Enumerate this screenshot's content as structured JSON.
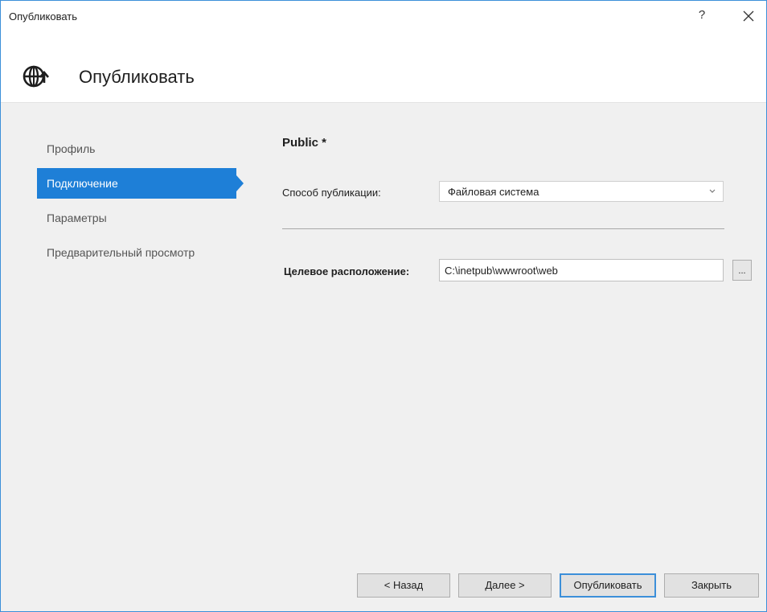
{
  "window": {
    "title": "Опубликовать",
    "help_label": "?"
  },
  "header": {
    "title": "Опубликовать"
  },
  "nav": {
    "items": [
      {
        "label": "Профиль"
      },
      {
        "label": "Подключение"
      },
      {
        "label": "Параметры"
      },
      {
        "label": "Предварительный просмотр"
      }
    ]
  },
  "main": {
    "profile_name": "Public *",
    "publish_method_label": "Способ публикации:",
    "publish_method_value": "Файловая система",
    "target_location_label": "Целевое расположение:",
    "target_location_value": "C:\\inetpub\\wwwroot\\web",
    "browse_label": "..."
  },
  "footer": {
    "back_label": "< Назад",
    "next_label": "Далее >",
    "publish_label": "Опубликовать",
    "close_label": "Закрыть"
  },
  "icons": {
    "header": "globe-publish-icon",
    "close": "close-icon",
    "dropdown": "chevron-down-icon"
  },
  "colors": {
    "accent": "#1e7fd7",
    "window_border": "#3c8fd9"
  }
}
